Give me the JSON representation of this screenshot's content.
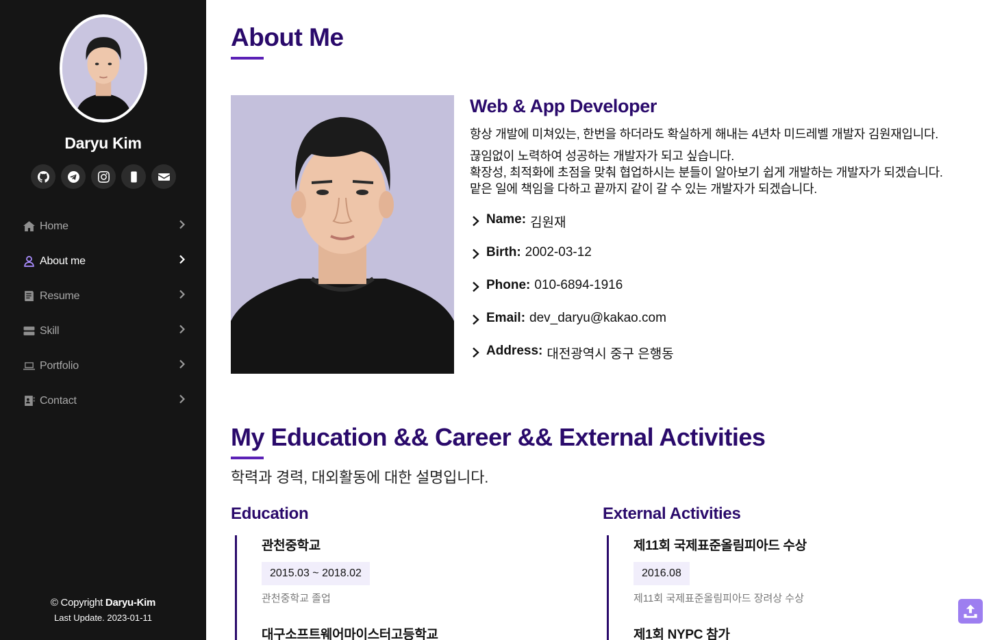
{
  "profile": {
    "name": "Daryu Kim"
  },
  "social": [
    {
      "icon": "github-icon"
    },
    {
      "icon": "telegram-icon"
    },
    {
      "icon": "instagram-icon"
    },
    {
      "icon": "mobile-phone-icon"
    },
    {
      "icon": "envelope-icon"
    }
  ],
  "nav": {
    "items": [
      {
        "label": "Home",
        "icon": "home-icon"
      },
      {
        "label": "About me",
        "icon": "user-icon",
        "active": true
      },
      {
        "label": "Resume",
        "icon": "resume-icon"
      },
      {
        "label": "Skill",
        "icon": "server-icon"
      },
      {
        "label": "Portfolio",
        "icon": "laptop-icon"
      },
      {
        "label": "Contact",
        "icon": "contact-book-icon"
      }
    ]
  },
  "footer": {
    "copyright_prefix": "© Copyright ",
    "copyright_owner": "Daryu-Kim",
    "last_update": "Last Update. 2023-01-11"
  },
  "about": {
    "title": "About Me",
    "role": "Web & App Developer",
    "intro_1": "항상 개발에 미쳐있는, 한번을 하더라도 확실하게 해내는 4년차 미드레벨 개발자 김원재입니다.",
    "intro_2": "끊임없이 노력하여 성공하는 개발자가 되고 싶습니다.",
    "intro_3": "확장성, 최적화에 초점을 맞춰 협업하시는 분들이 알아보기 쉽게 개발하는 개발자가 되겠습니다.",
    "intro_4": "맡은 일에 책임을 다하고 끝까지 같이 갈 수 있는 개발자가 되겠습니다.",
    "info": [
      {
        "key": "Name:",
        "value": "김원재"
      },
      {
        "key": "Birth:",
        "value": "2002-03-12"
      },
      {
        "key": "Phone:",
        "value": "010-6894-1916"
      },
      {
        "key": "Email:",
        "value": "dev_daryu@kakao.com"
      },
      {
        "key": "Address:",
        "value": "대전광역시 중구 은행동"
      }
    ]
  },
  "career": {
    "title": "My Education && Career && External Activities",
    "subtitle": "학력과 경력, 대외활동에 대한 설명입니다.",
    "education": {
      "title": "Education",
      "items": [
        {
          "name": "관천중학교",
          "date": "2015.03 ~ 2018.02",
          "desc": "관천중학교 졸업"
        },
        {
          "name": "대구소프트웨어마이스터고등학교"
        }
      ]
    },
    "external": {
      "title": "External Activities",
      "items": [
        {
          "name": "제11회 국제표준올림피아드 수상",
          "date": "2016.08",
          "desc": "제11회 국제표준올림피아드 장려상 수상"
        },
        {
          "name": "제1회 NYPC 참가"
        }
      ]
    }
  },
  "colors": {
    "accent": "#2a0a6b",
    "sidebar_bg": "#151515",
    "upload_btn": "#9d7ef0"
  }
}
